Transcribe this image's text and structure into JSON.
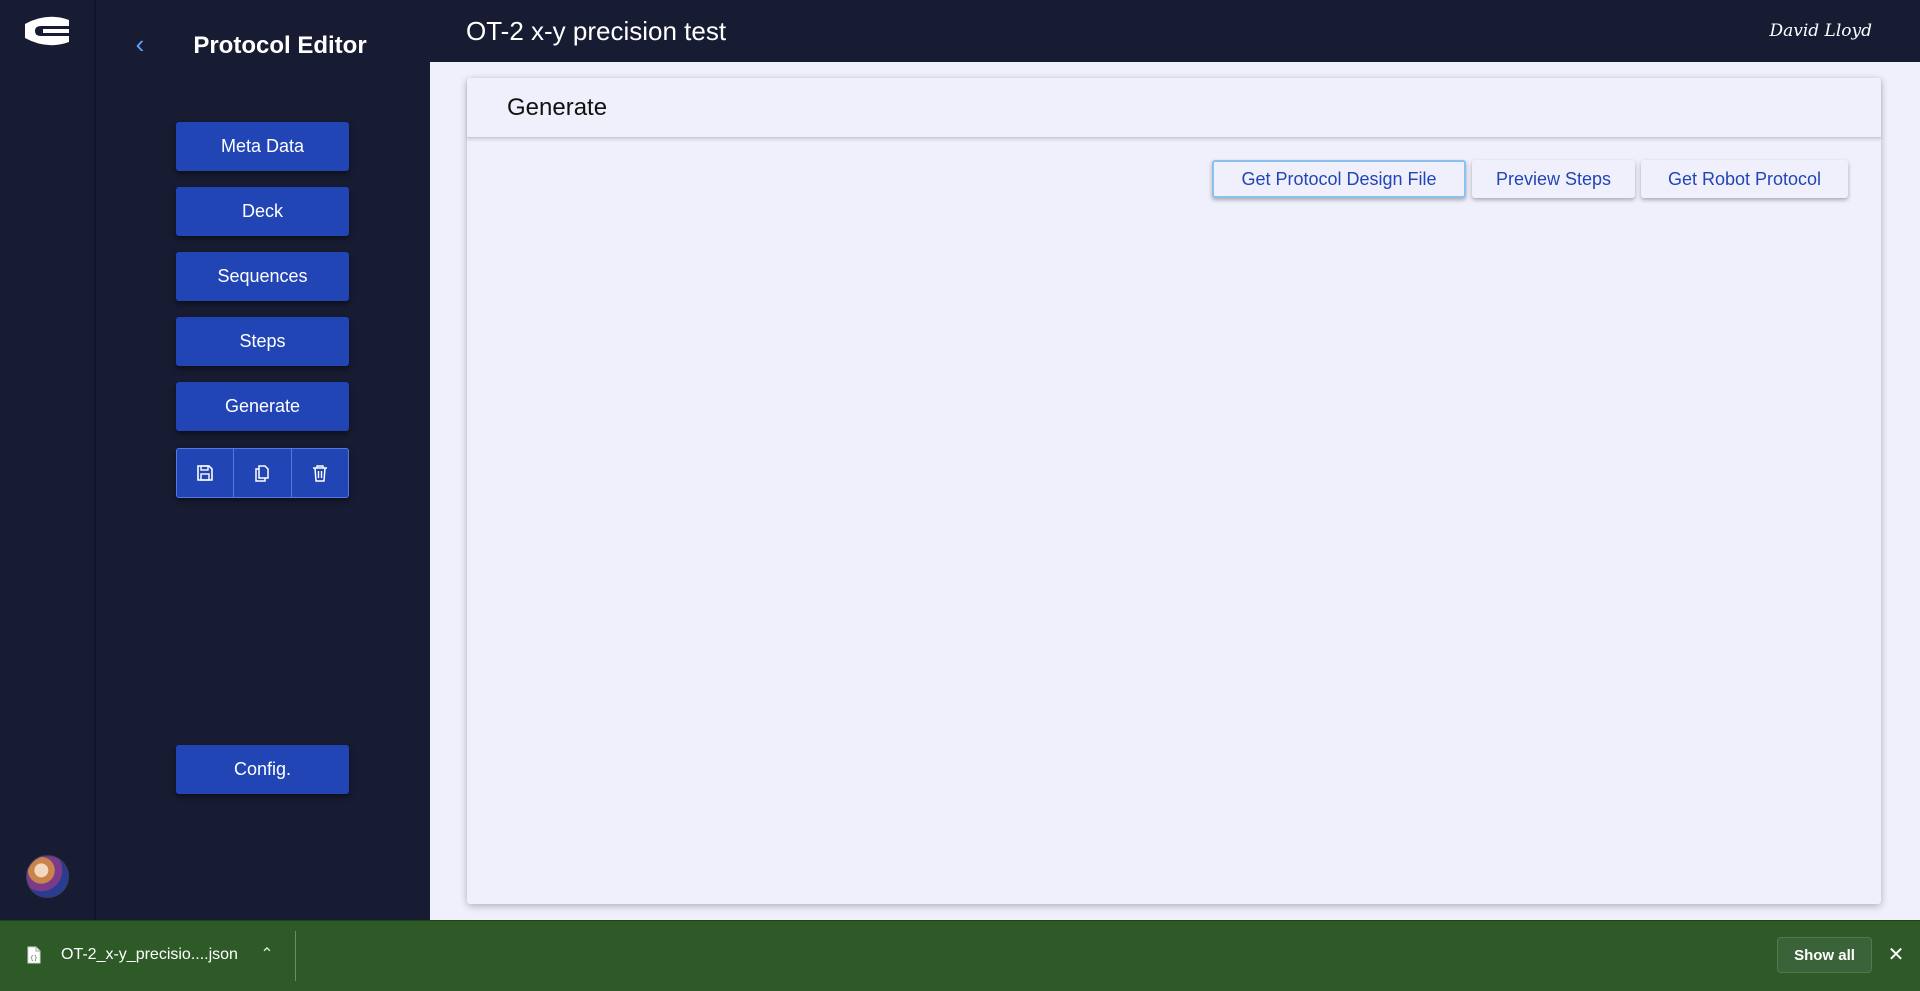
{
  "app": {
    "logo_icon": "brand-logo-icon",
    "avatar_icon": "user-avatar"
  },
  "sidebar": {
    "back_icon": "chevron-left-icon",
    "title": "Protocol Editor",
    "nav": [
      {
        "label": "Meta Data"
      },
      {
        "label": "Deck"
      },
      {
        "label": "Sequences"
      },
      {
        "label": "Steps"
      },
      {
        "label": "Generate"
      }
    ],
    "icon_actions": [
      {
        "icon": "save-icon"
      },
      {
        "icon": "copy-icon"
      },
      {
        "icon": "trash-icon"
      }
    ],
    "config_label": "Config."
  },
  "header": {
    "title": "OT-2 x-y precision test",
    "user_signature": "David Lloyd"
  },
  "main": {
    "card_title": "Generate",
    "actions": [
      {
        "label": "Get Protocol Design File",
        "focused": true
      },
      {
        "label": "Preview Steps"
      },
      {
        "label": "Get Robot Protocol"
      }
    ]
  },
  "download_bar": {
    "file_name": "OT-2_x-y_precisio....json",
    "file_icon": "file-icon",
    "expand_icon": "chevron-up-icon",
    "show_all_label": "Show all",
    "close_icon": "close-icon"
  },
  "colors": {
    "sidebar_bg": "#181c33",
    "nav_button": "#2245b5",
    "main_bg": "#f0f0fd",
    "download_bar": "#2d5a27"
  }
}
